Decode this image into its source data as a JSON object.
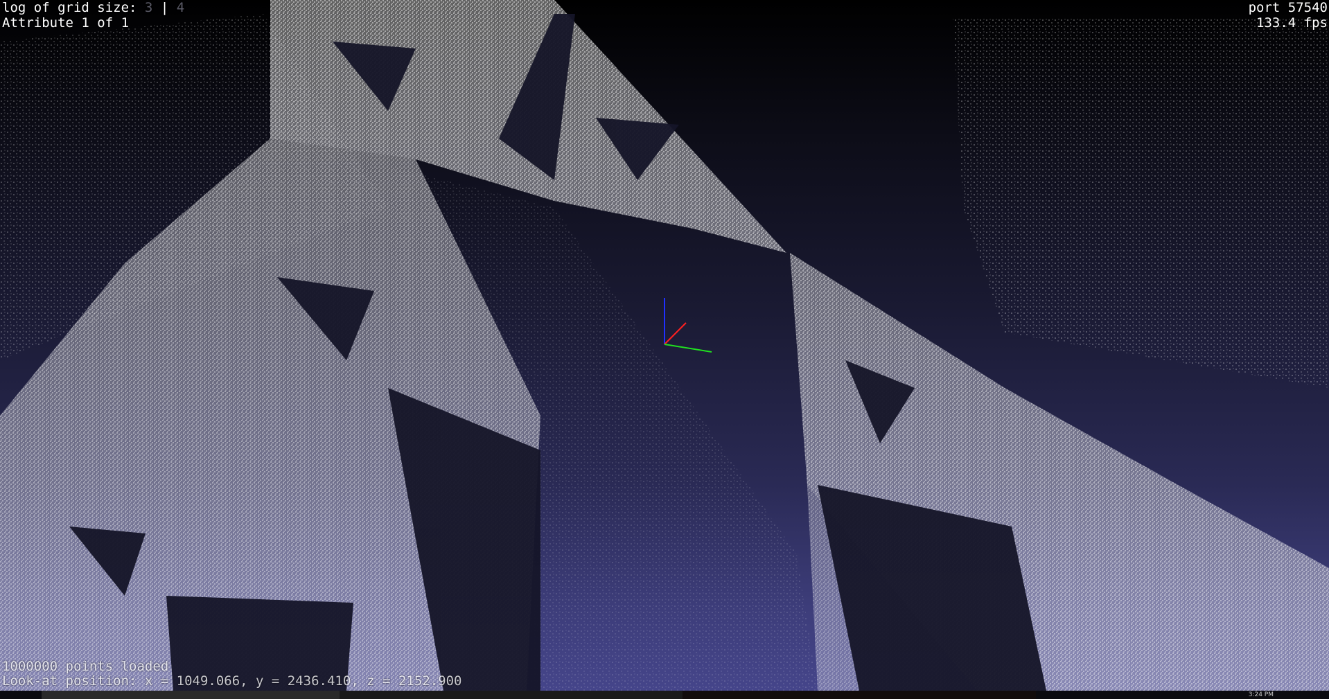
{
  "hud": {
    "grid_label": "log of grid size:",
    "grid_value_a": "3",
    "grid_sep": " | ",
    "grid_value_b": "4",
    "attribute": "Attribute 1 of 1",
    "port": "port 57540",
    "fps": "133.4 fps",
    "points_loaded": "1000000 points loaded",
    "look_at": "Look-at position: x = 1049.066, y = 2436.410, z = 2152.900"
  },
  "axes": {
    "x_color": "#ff2020",
    "y_color": "#20e020",
    "z_color": "#2030ff",
    "icon": "axis-gizmo-icon"
  },
  "scene": {
    "point_color": "#ffffff",
    "background_top": "#000000",
    "background_bottom": "#45458a",
    "subject": "sierpinski-fractal-point-cloud"
  },
  "taskbar": {
    "clock": "3:24 PM",
    "accent": "#2a2a2a"
  }
}
